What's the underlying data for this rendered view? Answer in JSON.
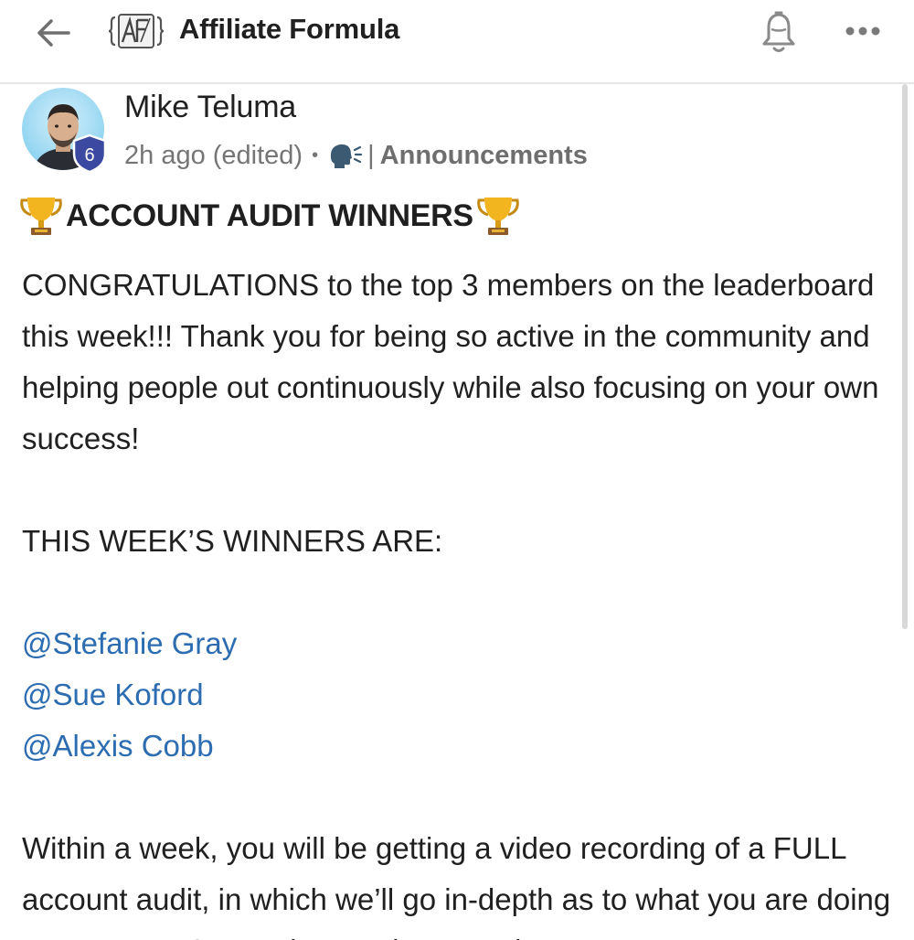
{
  "header": {
    "group_title": "Affiliate Formula",
    "back_icon": "arrow-left-icon",
    "logo_icon": "af-logo-icon",
    "bell_icon": "bell-icon",
    "more_icon": "more-horizontal-icon"
  },
  "post": {
    "author": "Mike Teluma",
    "level": "6",
    "time": "2h ago (edited)",
    "separator_dot": "•",
    "category_separator": "|",
    "category": "Announcements",
    "title": "ACCOUNT AUDIT WINNERS",
    "paragraph1": "CONGRATULATIONS to the top 3 members on the leaderboard this week!!! Thank you for being so active in the community and helping people out continuously while also focusing on your own success!",
    "paragraph2": "THIS WEEK’S WINNERS ARE:",
    "mentions": [
      "@Stefanie Gray",
      "@Sue Koford",
      "@Alexis Cobb"
    ],
    "paragraph3": "Within a week, you will be getting a video recording of a FULL account audit, in which we’ll go in-depth as to what you are doing great + EXACTLY where to improve :)"
  },
  "colors": {
    "mention": "#2c6cb0",
    "badge": "#3b4aa0",
    "text": "#202020",
    "meta": "#757575"
  }
}
